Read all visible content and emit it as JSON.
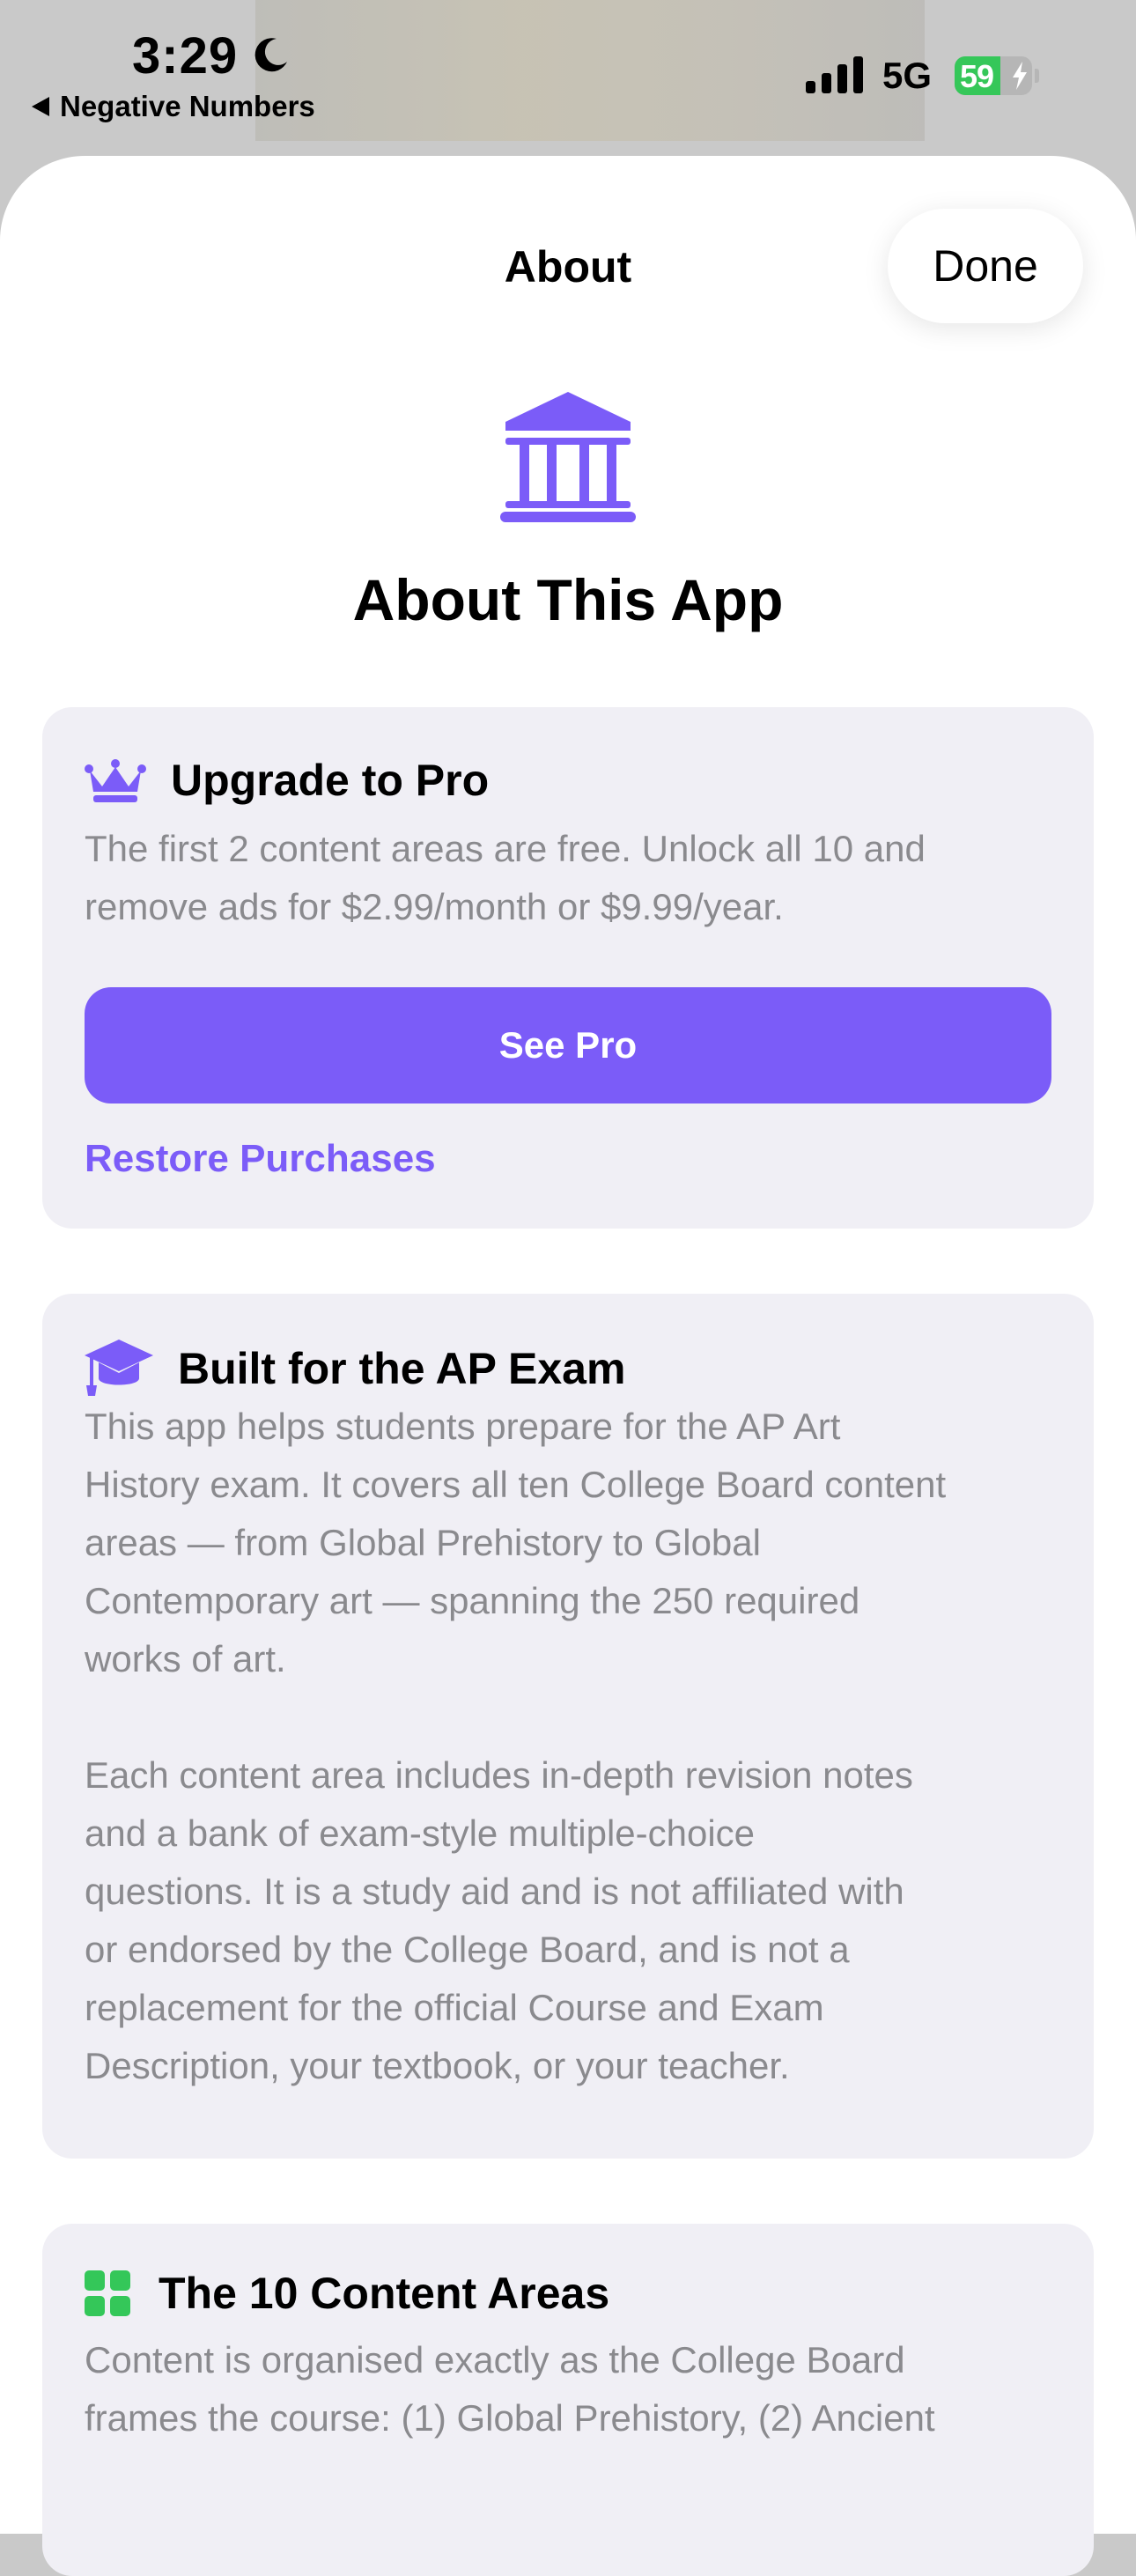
{
  "status_bar": {
    "time": "3:29",
    "back_app": "Negative Numbers",
    "network": "5G",
    "battery_percent": "59",
    "battery_level": 0.59
  },
  "nav": {
    "title": "About",
    "done_label": "Done"
  },
  "hero": {
    "icon": "building-columns-icon",
    "title": "About This App"
  },
  "upgrade_card": {
    "icon": "crown-icon",
    "title": "Upgrade to Pro",
    "body_line_1": "The first 2 content areas are free. Unlock all 10 and",
    "body_line_2": "remove ads for $2.99/month or $9.99/year.",
    "button_label": "See Pro",
    "restore_label": "Restore Purchases"
  },
  "exam_card": {
    "icon": "graduation-cap-icon",
    "title": "Built for the AP Exam",
    "paragraph_1": [
      "This app helps students prepare for the AP Art",
      "History exam. It covers all ten College Board content",
      "areas — from Global Prehistory to Global",
      "Contemporary art — spanning the 250 required",
      "works of art."
    ],
    "paragraph_2": [
      "Each content area includes in-depth revision notes",
      "and a bank of exam-style multiple-choice",
      "questions. It is a study aid and is not affiliated with",
      "or endorsed by the College Board, and is not a",
      "replacement for the official Course and Exam",
      "Description, your textbook, or your teacher."
    ]
  },
  "areas_card": {
    "icon": "grid-icon",
    "title": "The 10 Content Areas",
    "body_lines": [
      "Content is organised exactly as the College Board",
      "frames the course: (1) Global Prehistory, (2) Ancient"
    ]
  },
  "colors": {
    "accent": "#7b5cf8",
    "card_background": "#f0eff5",
    "secondary_text": "#8a8a8e",
    "grid_icon": "#34c759",
    "battery_green": "#35c759"
  }
}
